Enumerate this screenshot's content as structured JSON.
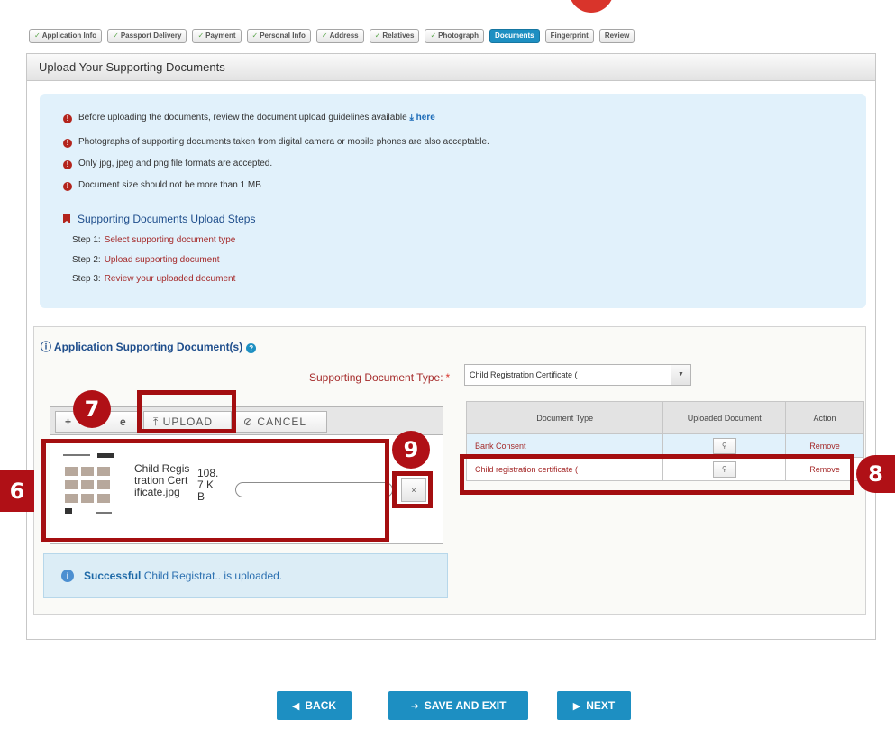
{
  "tabs": [
    {
      "label": "Application Info",
      "check": "✓",
      "active": false
    },
    {
      "label": "Passport Delivery",
      "check": "✓",
      "active": false
    },
    {
      "label": "Payment",
      "check": "✓",
      "active": false
    },
    {
      "label": "Personal Info",
      "check": "✓",
      "active": false
    },
    {
      "label": "Address",
      "check": "✓",
      "active": false
    },
    {
      "label": "Relatives",
      "check": "✓",
      "active": false
    },
    {
      "label": "Photograph",
      "check": "✓",
      "active": false
    },
    {
      "label": "Documents",
      "check": "",
      "active": true
    },
    {
      "label": "Fingerprint",
      "check": "",
      "active": false
    },
    {
      "label": "Review",
      "check": "",
      "active": false
    }
  ],
  "panel": {
    "title": "Upload Your Supporting Documents"
  },
  "info": {
    "bullets": [
      "Before uploading the documents, review the document upload guidelines available",
      "Photographs of supporting documents taken from digital camera or mobile phones are also acceptable.",
      "Only jpg, jpeg and png file formats are accepted.",
      "Document size should not be more than 1 MB"
    ],
    "here_label": "here",
    "steps_title": "Supporting Documents Upload Steps",
    "steps": [
      {
        "num": "Step 1:",
        "text": "Select supporting document type"
      },
      {
        "num": "Step 2:",
        "text": "Upload supporting document"
      },
      {
        "num": "Step 3:",
        "text": "Review your uploaded document"
      }
    ]
  },
  "section": {
    "title": "Application Supporting Document(s)",
    "doc_type_label": "Supporting Document Type:",
    "required_mark": "*",
    "doc_type_value": "Child Registration Certificate ("
  },
  "uploader": {
    "add_label": "+",
    "add_suffix": "e",
    "upload_label": "UPLOAD",
    "cancel_label": "CANCEL",
    "file_name": "Child Registration Certificate.jpg",
    "file_size": "108.7 KB",
    "remove_label": "×",
    "success_strong": "Successful",
    "success_text": "Child Registrat.. is uploaded."
  },
  "table": {
    "headers": [
      "Document Type",
      "Uploaded Document",
      "Action"
    ],
    "rows": [
      {
        "type": "Bank Consent",
        "action": "Remove"
      },
      {
        "type": "Child registration certificate (",
        "action": "Remove"
      }
    ]
  },
  "annotations": {
    "n6": "6",
    "n7": "7",
    "n8": "8",
    "n9": "9"
  },
  "nav": {
    "back": "BACK",
    "save_exit": "SAVE AND EXIT",
    "next": "NEXT"
  },
  "colors": {
    "accent": "#1d8fc2",
    "annotation": "#a40e10",
    "link_red": "#a52a2a",
    "title_blue": "#1f4e8c"
  }
}
